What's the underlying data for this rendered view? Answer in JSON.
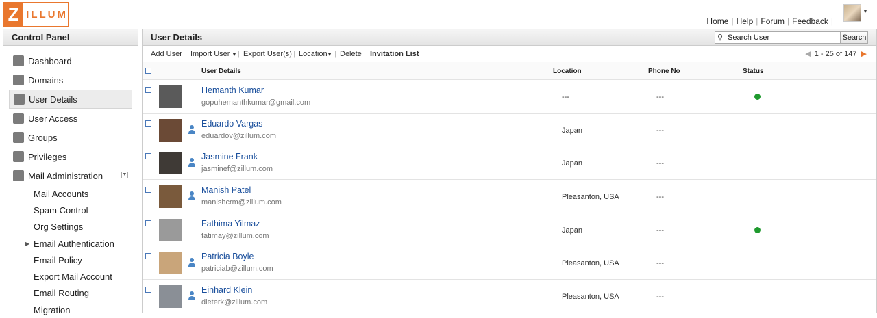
{
  "brand": {
    "logo_letter": "Z",
    "logo_rest": "ILLUM",
    "color": "#e9772e"
  },
  "toplinks": [
    "Home",
    "Help",
    "Forum",
    "Feedback"
  ],
  "sidebar": {
    "title": "Control Panel",
    "items": [
      {
        "label": "Dashboard",
        "icon": "dashboard-icon"
      },
      {
        "label": "Domains",
        "icon": "domains-icon"
      },
      {
        "label": "User Details",
        "icon": "user-icon",
        "active": true
      },
      {
        "label": "User Access",
        "icon": "user-access-icon"
      },
      {
        "label": "Groups",
        "icon": "groups-icon"
      },
      {
        "label": "Privileges",
        "icon": "privileges-icon"
      },
      {
        "label": "Mail Administration",
        "icon": "mail-icon",
        "expandable": true
      }
    ],
    "subitems": [
      {
        "label": "Mail Accounts"
      },
      {
        "label": "Spam Control"
      },
      {
        "label": "Org Settings"
      },
      {
        "label": "Email Authentication",
        "collapsed": true
      },
      {
        "label": "Email Policy"
      },
      {
        "label": "Export Mail Account"
      },
      {
        "label": "Email Routing"
      },
      {
        "label": "Migration"
      }
    ]
  },
  "main": {
    "title": "User Details",
    "search": {
      "placeholder": "Search User",
      "button": "Search"
    },
    "toolbar": {
      "add_user": "Add User",
      "import_user": "Import User",
      "export_users": "Export User(s)",
      "location": "Location",
      "delete": "Delete",
      "invitation_list": "Invitation List"
    },
    "pager": "1 - 25 of 147",
    "columns": {
      "user_details": "User Details",
      "location": "Location",
      "phone": "Phone No",
      "status": "Status"
    },
    "rows": [
      {
        "name": "Hemanth Kumar",
        "email": "gopuhemanthkumar@gmail.com",
        "location": "---",
        "phone": "---",
        "status": "online",
        "user_icon": false,
        "photo": "#5a5a5a"
      },
      {
        "name": "Eduardo Vargas",
        "email": "eduardov@zillum.com",
        "location": "Japan",
        "phone": "---",
        "status": "",
        "user_icon": true,
        "photo": "#6b4a36"
      },
      {
        "name": "Jasmine Frank",
        "email": "jasminef@zillum.com",
        "location": "Japan",
        "phone": "---",
        "status": "",
        "user_icon": true,
        "photo": "#3f3a36"
      },
      {
        "name": "Manish Patel",
        "email": "manishcrm@zillum.com",
        "location": "Pleasanton, USA",
        "phone": "---",
        "status": "",
        "user_icon": true,
        "photo": "#7a5a3c"
      },
      {
        "name": "Fathima Yilmaz",
        "email": "fatimay@zillum.com",
        "location": "Japan",
        "phone": "---",
        "status": "online",
        "user_icon": false,
        "photo": "#9a9a9a"
      },
      {
        "name": "Patricia Boyle",
        "email": "patriciab@zillum.com",
        "location": "Pleasanton, USA",
        "phone": "---",
        "status": "",
        "user_icon": true,
        "photo": "#c9a57a"
      },
      {
        "name": "Einhard Klein",
        "email": "dieterk@zillum.com",
        "location": "Pleasanton, USA",
        "phone": "---",
        "status": "",
        "user_icon": true,
        "photo": "#8a8f96"
      }
    ]
  }
}
